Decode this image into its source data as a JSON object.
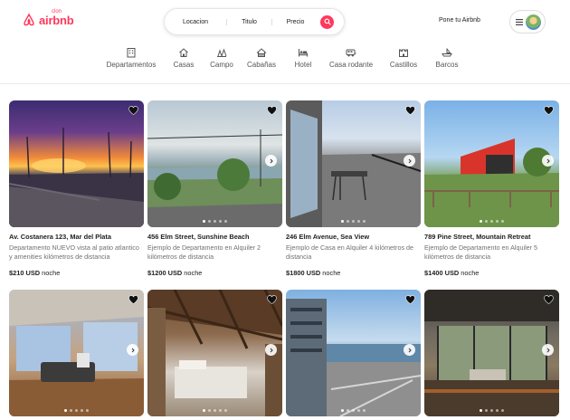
{
  "header": {
    "logo_text": "airbnb",
    "logo_super": "clon",
    "search": {
      "location": "Locacion",
      "title": "Titulo",
      "price": "Precio"
    },
    "host_link": "Pone tu Airbnb"
  },
  "categories": [
    {
      "label": "Departamentos",
      "icon": "building-icon"
    },
    {
      "label": "Casas",
      "icon": "house-icon"
    },
    {
      "label": "Campo",
      "icon": "countryside-icon"
    },
    {
      "label": "Cabañas",
      "icon": "cabin-icon"
    },
    {
      "label": "Hotel",
      "icon": "hotel-icon"
    },
    {
      "label": "Casa rodante",
      "icon": "camper-icon"
    },
    {
      "label": "Castillos",
      "icon": "castle-icon"
    },
    {
      "label": "Barcos",
      "icon": "boat-icon"
    }
  ],
  "listings": [
    {
      "title": "Av. Costanera 123, Mar del Plata",
      "description": "Departamento NUEVO vista al patio atlantico y amenities kilómetros de distancia",
      "price": "$210 USD",
      "unit": "noche"
    },
    {
      "title": "456 Elm Street, Sunshine Beach",
      "description": "Ejemplo de Departamento en Alquiler 2 kilómetros de distancia",
      "price": "$1200 USD",
      "unit": "noche"
    },
    {
      "title": "246 Elm Avenue, Sea View",
      "description": "Ejemplo de Casa en Alquiler 4 kilómetros de distancia",
      "price": "$1800 USD",
      "unit": "noche"
    },
    {
      "title": "789 Pine Street, Mountain Retreat",
      "description": "Ejemplo de Departamento en Alquiler 5 kilómetros de distancia",
      "price": "$1400 USD",
      "unit": "noche"
    },
    {
      "title": "",
      "description": "",
      "price": "",
      "unit": ""
    },
    {
      "title": "",
      "description": "",
      "price": "",
      "unit": ""
    },
    {
      "title": "",
      "description": "",
      "price": "",
      "unit": ""
    },
    {
      "title": "",
      "description": "",
      "price": "",
      "unit": ""
    }
  ],
  "colors": {
    "brand": "#ff385c"
  }
}
